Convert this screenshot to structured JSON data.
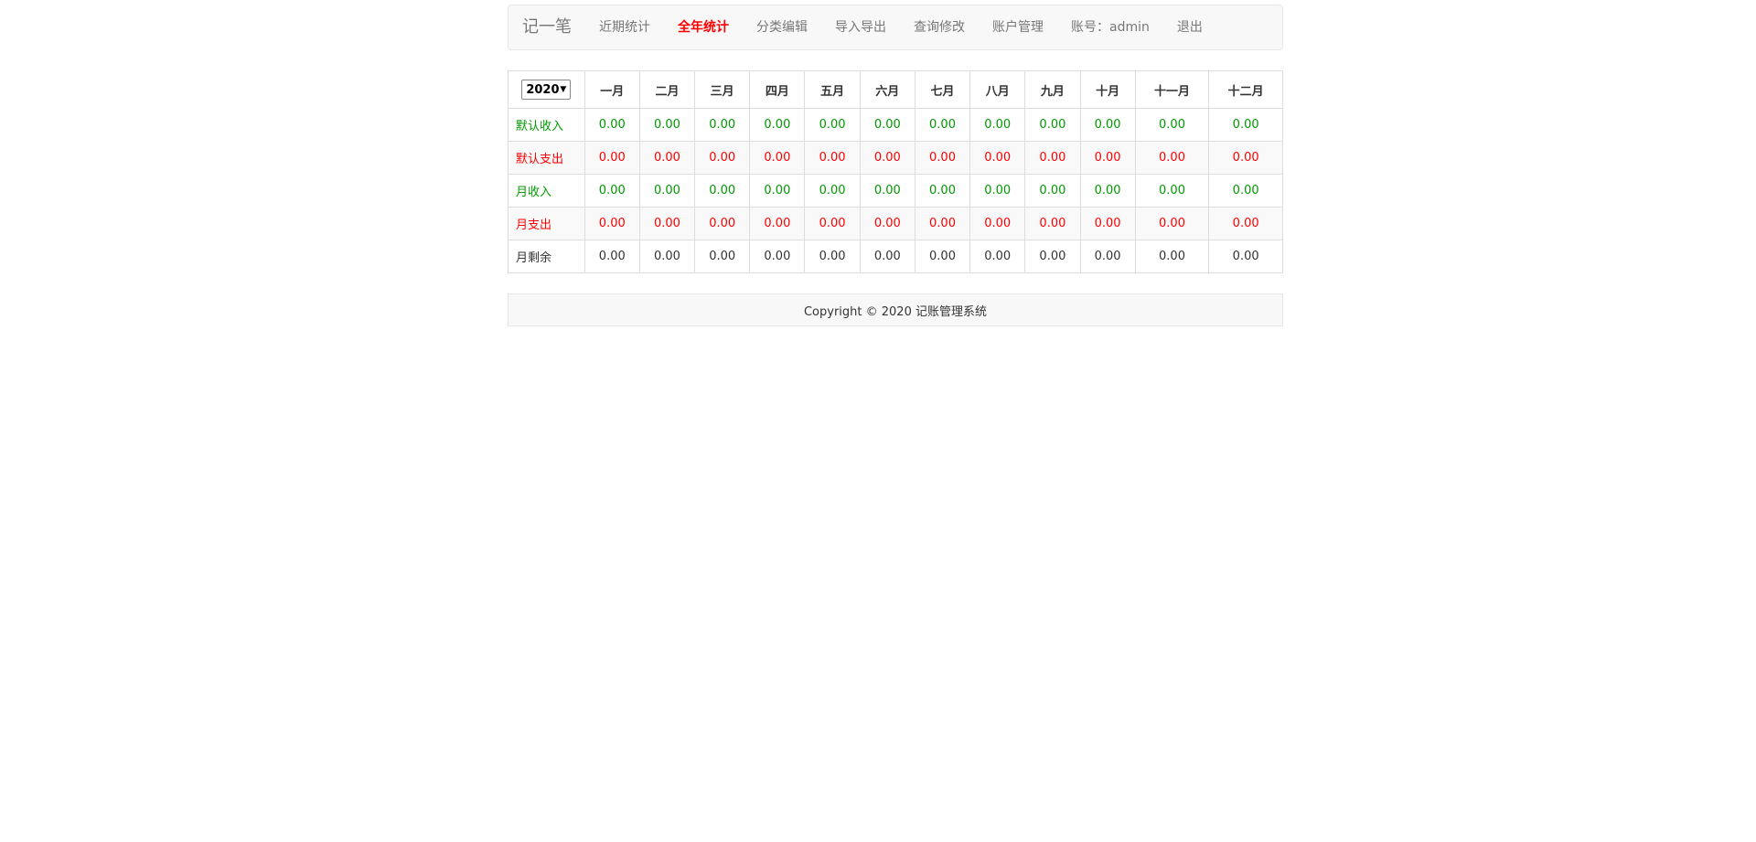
{
  "navbar": {
    "brand": "记一笔",
    "items": [
      {
        "label": "近期统计",
        "active": false
      },
      {
        "label": "全年统计",
        "active": true
      },
      {
        "label": "分类编辑",
        "active": false
      },
      {
        "label": "导入导出",
        "active": false
      },
      {
        "label": "查询修改",
        "active": false
      },
      {
        "label": "账户管理",
        "active": false
      },
      {
        "label": "账号：admin",
        "active": false
      },
      {
        "label": "退出",
        "active": false
      }
    ]
  },
  "table": {
    "year_select": {
      "value": "2020",
      "caret_icon": "caret-down-icon"
    },
    "months": [
      "一月",
      "二月",
      "三月",
      "四月",
      "五月",
      "六月",
      "七月",
      "八月",
      "九月",
      "十月",
      "十一月",
      "十二月"
    ],
    "rows": [
      {
        "label": "默认收入",
        "color": "green",
        "values": [
          "0.00",
          "0.00",
          "0.00",
          "0.00",
          "0.00",
          "0.00",
          "0.00",
          "0.00",
          "0.00",
          "0.00",
          "0.00",
          "0.00"
        ]
      },
      {
        "label": "默认支出",
        "color": "red",
        "values": [
          "0.00",
          "0.00",
          "0.00",
          "0.00",
          "0.00",
          "0.00",
          "0.00",
          "0.00",
          "0.00",
          "0.00",
          "0.00",
          "0.00"
        ]
      },
      {
        "label": "月收入",
        "color": "green",
        "values": [
          "0.00",
          "0.00",
          "0.00",
          "0.00",
          "0.00",
          "0.00",
          "0.00",
          "0.00",
          "0.00",
          "0.00",
          "0.00",
          "0.00"
        ]
      },
      {
        "label": "月支出",
        "color": "red",
        "values": [
          "0.00",
          "0.00",
          "0.00",
          "0.00",
          "0.00",
          "0.00",
          "0.00",
          "0.00",
          "0.00",
          "0.00",
          "0.00",
          "0.00"
        ]
      },
      {
        "label": "月剩余",
        "color": "dark",
        "values": [
          "0.00",
          "0.00",
          "0.00",
          "0.00",
          "0.00",
          "0.00",
          "0.00",
          "0.00",
          "0.00",
          "0.00",
          "0.00",
          "0.00"
        ]
      }
    ]
  },
  "footer": {
    "text": "Copyright © 2020 记账管理系统"
  },
  "colors": {
    "income": "#009900",
    "expense": "#ff0000",
    "active_nav": "#ff0000"
  }
}
